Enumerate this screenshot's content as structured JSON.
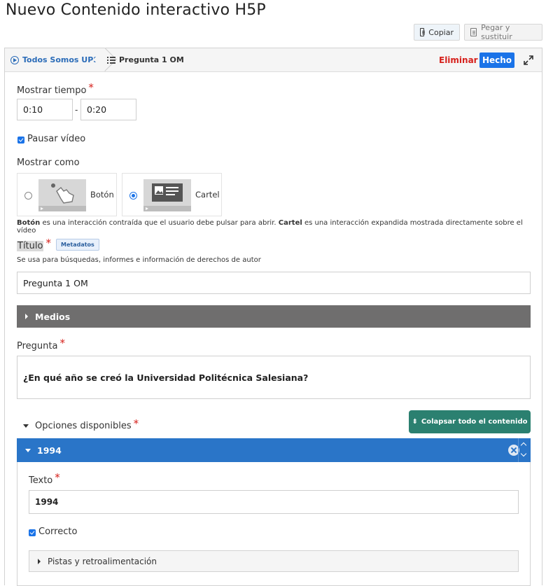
{
  "page_title": "Nuevo Contenido interactivo H5P",
  "top_buttons": {
    "copy": "Copiar",
    "paste": "Pegar y sustituir"
  },
  "breadcrumb": {
    "root": "Todos Somos UPS",
    "current": "Pregunta 1 OM"
  },
  "toolbar": {
    "delete": "Eliminar",
    "done": "Hecho"
  },
  "display_time": {
    "label": "Mostrar tiempo",
    "from": "0:10",
    "separator": "-",
    "to": "0:20"
  },
  "pause_video": {
    "label": "Pausar vídeo",
    "checked": true
  },
  "display_as": {
    "label": "Mostrar como",
    "options": [
      {
        "label": "Botón",
        "selected": false
      },
      {
        "label": "Cartel",
        "selected": true
      }
    ],
    "help_boton": "Botón",
    "help_text1": " es una interacción contraída que el usuario debe pulsar para abrir. ",
    "help_cartel": "Cartel",
    "help_text2": " es una interacción expandida mostrada directamente sobre el vídeo"
  },
  "title_field": {
    "label": "Título",
    "metadata_button": "Metadatos",
    "help": "Se usa para búsquedas, informes e información de derechos de autor",
    "value": "Pregunta 1 OM"
  },
  "media_section": {
    "label": "Medios"
  },
  "question": {
    "label": "Pregunta",
    "value": "¿En qué año se creó la Universidad Politécnica Salesiana?"
  },
  "options": {
    "label": "Opciones disponibles",
    "collapse_all": "Colapsar todo el contenido",
    "items": [
      {
        "title": "1994",
        "text_label": "Texto",
        "text_value": "1994",
        "correct_label": "Correcto",
        "correct": true,
        "hints_label": "Pistas y retroalimentación"
      }
    ]
  },
  "colors": {
    "primary": "#1a73e8",
    "danger": "#d6201b",
    "item_header": "#2a75c8",
    "collapse_button": "#2b8070",
    "media_bar": "#6f6e6e"
  }
}
